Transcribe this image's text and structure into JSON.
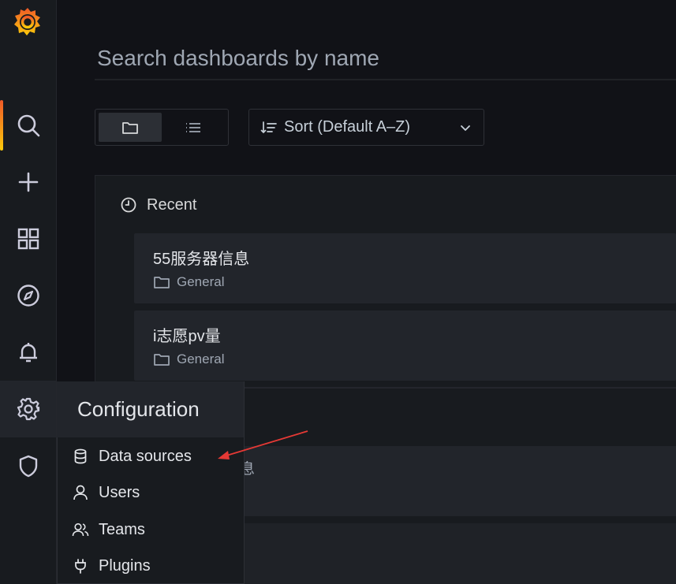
{
  "search": {
    "placeholder": "Search dashboards by name"
  },
  "sort": {
    "label": "Sort (Default A–Z)"
  },
  "recent": {
    "heading": "Recent",
    "items": [
      {
        "title": "55服务器信息",
        "folder": "General"
      },
      {
        "title": "i志愿pv量",
        "folder": "General"
      }
    ],
    "partial_text": "息"
  },
  "config_menu": {
    "title": "Configuration",
    "items": [
      {
        "label": "Data sources",
        "icon": "database-icon"
      },
      {
        "label": "Users",
        "icon": "user-icon"
      },
      {
        "label": "Teams",
        "icon": "users-icon"
      },
      {
        "label": "Plugins",
        "icon": "plug-icon"
      }
    ]
  },
  "sidebar": {
    "items": [
      "grafana-logo",
      "search-icon",
      "plus-icon",
      "apps-icon",
      "compass-icon",
      "bell-icon",
      "cog-icon",
      "shield-icon"
    ]
  },
  "colors": {
    "accent": "#f05a28",
    "annotation": "#e53935"
  }
}
